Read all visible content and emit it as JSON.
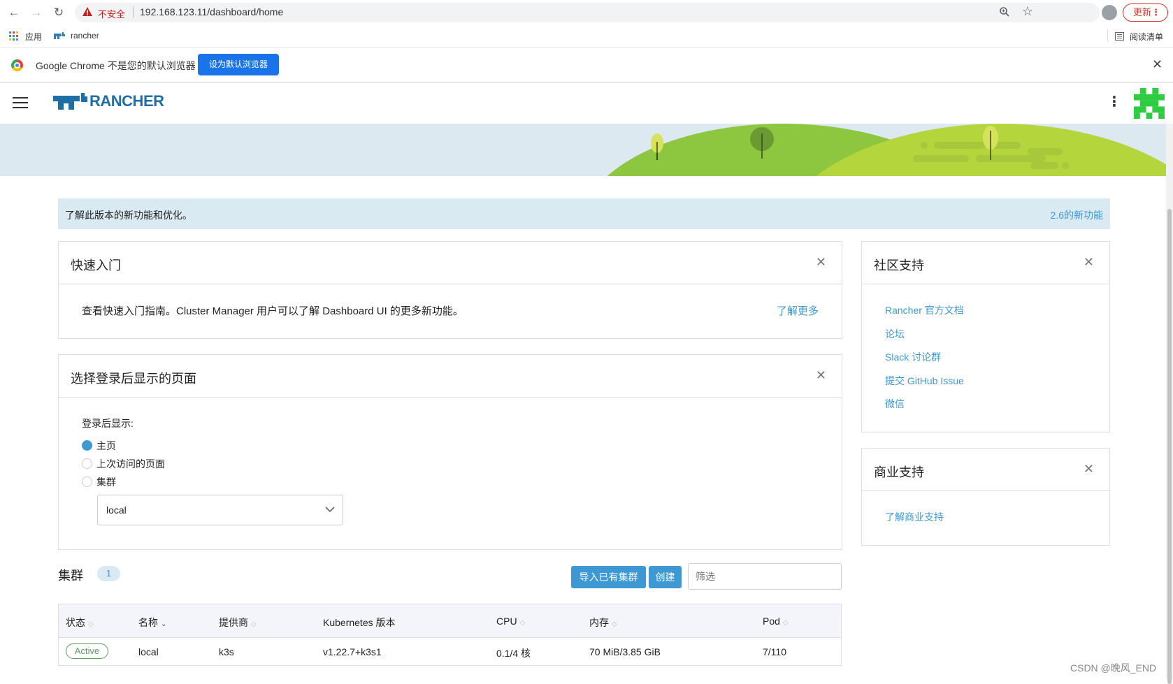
{
  "browser": {
    "insecure_label": "不安全",
    "url": "192.168.123.11/dashboard/home",
    "update_label": "更新",
    "bookmarks": {
      "apps": "应用",
      "rancher": "rancher",
      "reading_list": "阅读清单"
    }
  },
  "infobar": {
    "text": "Google Chrome 不是您的默认浏览器",
    "set_default_label": "设为默认浏览器",
    "close": "✕"
  },
  "header": {
    "logo_text": "RANCHER"
  },
  "notice": {
    "text": "了解此版本的新功能和优化。",
    "link": "2.6的新功能"
  },
  "quickstart": {
    "title": "快速入门",
    "body": "查看快速入门指南。Cluster Manager 用户可以了解 Dashboard UI 的更多新功能。",
    "link": "了解更多"
  },
  "landing": {
    "title": "选择登录后显示的页面",
    "label": "登录后显示:",
    "options": [
      "主页",
      "上次访问的页面",
      "集群"
    ],
    "selected_index": 0,
    "cluster_select_value": "local"
  },
  "community": {
    "title": "社区支持",
    "links": [
      "Rancher 官方文档",
      "论坛",
      "Slack 讨论群",
      "提交 GitHub Issue",
      "微信"
    ]
  },
  "commercial": {
    "title": "商业支持",
    "link": "了解商业支持"
  },
  "clusters": {
    "title": "集群",
    "count": "1",
    "import_label": "导入已有集群",
    "create_label": "创建",
    "filter_placeholder": "筛选",
    "columns": [
      "状态",
      "名称",
      "提供商",
      "Kubernetes 版本",
      "CPU",
      "内存",
      "Pod"
    ],
    "rows": [
      {
        "state": "Active",
        "name": "local",
        "provider": "k3s",
        "version": "v1.22.7+k3s1",
        "cpu": "0.1/4 核",
        "memory": "70 MiB/3.85 GiB",
        "pods": "7/110"
      }
    ]
  },
  "watermark": "CSDN @晚风_END",
  "colors": {
    "accent": "#3d98d3",
    "active": "#5d995d",
    "banner_sky": "#dde9f0",
    "hill_dark": "#8dc63f",
    "hill_light": "#b5d53d"
  }
}
